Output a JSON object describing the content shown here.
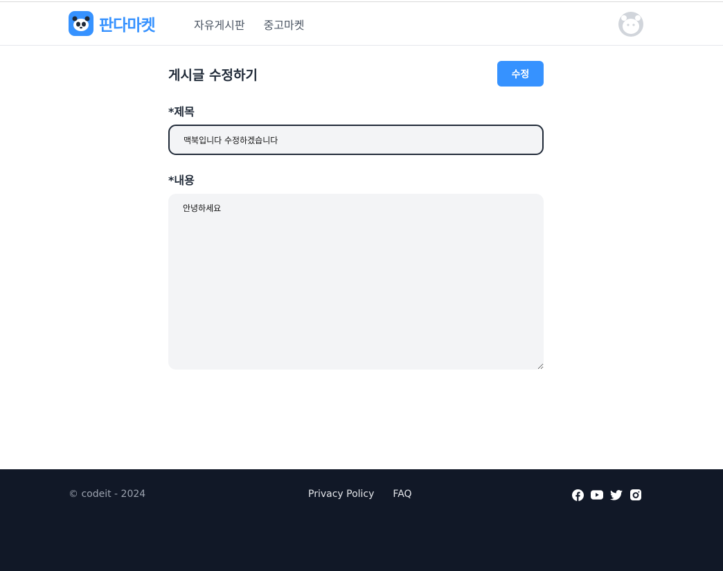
{
  "header": {
    "logo_text": "판다마켓",
    "nav": [
      {
        "label": "자유게시판"
      },
      {
        "label": "중고마켓"
      }
    ]
  },
  "form": {
    "title": "게시글 수정하기",
    "submit_label": "수정",
    "title_label": "*제목",
    "title_value": "맥북입니다 수정하겠습니다",
    "content_label": "*내용",
    "content_value": "안녕하세요"
  },
  "footer": {
    "copyright": "© codeit - 2024",
    "links": [
      {
        "label": "Privacy Policy"
      },
      {
        "label": "FAQ"
      }
    ],
    "social_icons": [
      "facebook-icon",
      "youtube-icon",
      "twitter-icon",
      "instagram-icon"
    ]
  },
  "colors": {
    "brand": "#3692ff",
    "footer_bg": "#111827",
    "input_bg": "#f3f4f6"
  }
}
